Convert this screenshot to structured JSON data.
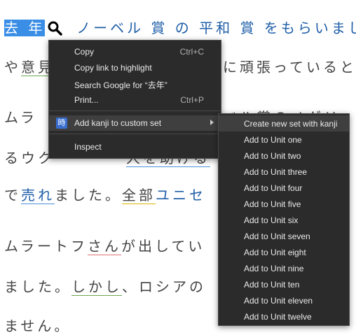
{
  "text_lines": {
    "l1a": "去 年",
    "l1b": "ノーベル 賞 の 平和 賞 をもらいまし",
    "l2a": "や",
    "l2b": "意見",
    "l2c": "に頑張っていると",
    "l3a": "ムラ",
    "l3b": "ベル賞のノグリ",
    "l4a": "るウク",
    "l4b": "人を助ける",
    "l5a": "で",
    "l5b": "売れ",
    "l5c": "ました。",
    "l5d": "全部",
    "l5e": "ユニセ",
    "l6a": "ムラートフ",
    "l6b": "さん",
    "l6c": "が",
    "l6d": "出",
    "l6e": "してい",
    "l7a": "ました。",
    "l7b": "しかし",
    "l7c": "、ロシアの",
    "l8a": "ません。"
  },
  "context_menu": {
    "copy": "Copy",
    "copy_shortcut": "Ctrl+C",
    "copy_link": "Copy link to highlight",
    "search": "Search Google for “去年”",
    "print": "Print...",
    "print_shortcut": "Ctrl+P",
    "kanji_icon": "時",
    "add_kanji": "Add kanji to custom set",
    "inspect": "Inspect"
  },
  "submenu": {
    "items": [
      "Create new set with kanji",
      "Add to Unit one",
      "Add to Unit two",
      "Add to Unit three",
      "Add to Unit four",
      "Add to Unit five",
      "Add to Unit six",
      "Add to Unit seven",
      "Add to Unit eight",
      "Add to Unit nine",
      "Add to Unit ten",
      "Add to Unit eleven",
      "Add to Unit twelve"
    ]
  }
}
